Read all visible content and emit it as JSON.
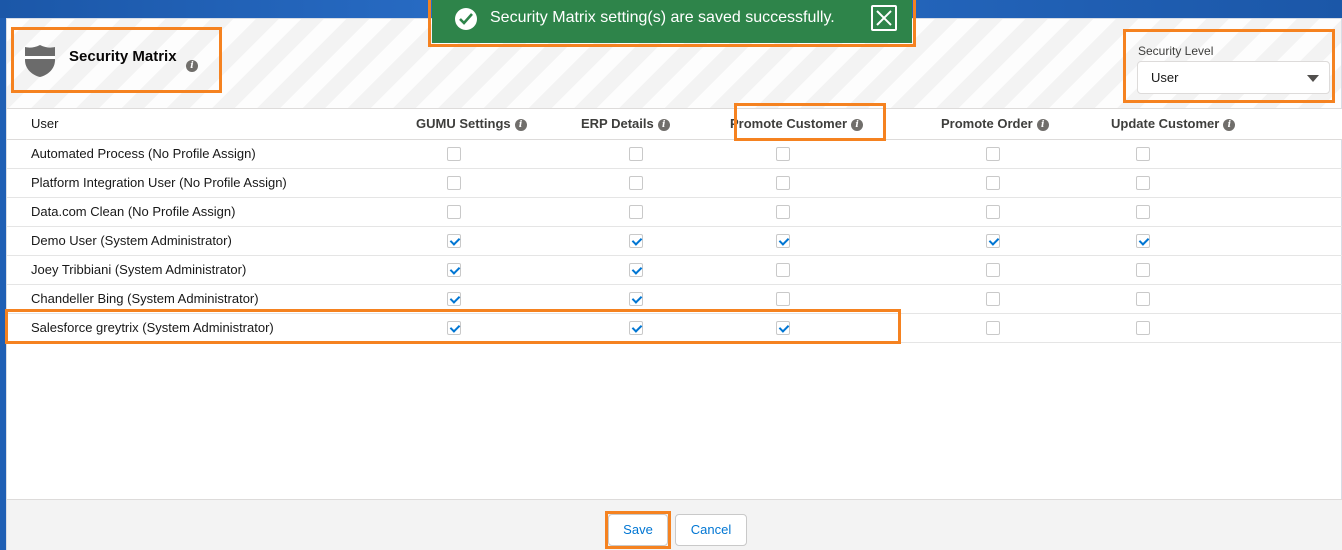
{
  "header": {
    "title": "Security Matrix",
    "title_icon": "shield-icon",
    "info_icon": "info-icon"
  },
  "toast": {
    "message": "Security Matrix setting(s) are saved successfully.",
    "status": "success",
    "color": "#2e844a",
    "close_icon": "close-icon"
  },
  "security_level": {
    "label": "Security Level",
    "value": "User"
  },
  "table": {
    "columns": [
      "User",
      "GUMU Settings",
      "ERP Details",
      "Promote Customer",
      "Promote Order",
      "Update Customer"
    ],
    "rows": [
      {
        "user": "Automated Process (No Profile Assign)",
        "values": [
          false,
          false,
          false,
          false,
          false
        ]
      },
      {
        "user": "Platform Integration User (No Profile Assign)",
        "values": [
          false,
          false,
          false,
          false,
          false
        ]
      },
      {
        "user": "Data.com Clean (No Profile Assign)",
        "values": [
          false,
          false,
          false,
          false,
          false
        ]
      },
      {
        "user": "Demo User (System Administrator)",
        "values": [
          true,
          true,
          true,
          true,
          true
        ]
      },
      {
        "user": "Joey Tribbiani (System Administrator)",
        "values": [
          true,
          true,
          false,
          false,
          false
        ]
      },
      {
        "user": "Chandeller Bing (System Administrator)",
        "values": [
          true,
          true,
          false,
          false,
          false
        ]
      },
      {
        "user": "Salesforce greytrix (System Administrator)",
        "values": [
          true,
          true,
          true,
          false,
          false
        ]
      }
    ]
  },
  "footer": {
    "save_label": "Save",
    "cancel_label": "Cancel"
  },
  "colors": {
    "highlight": "#f58220",
    "checkbox_check": "#0176d3"
  }
}
